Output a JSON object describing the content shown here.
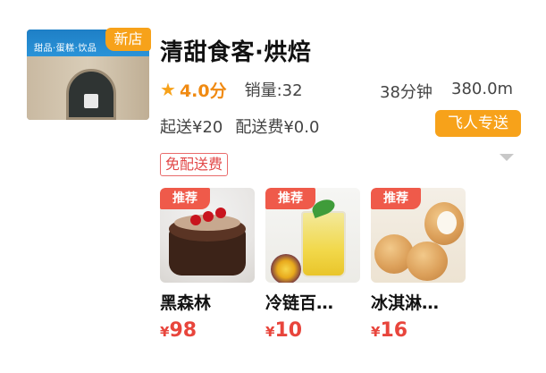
{
  "store": {
    "sign_text": "甜品·蛋糕·饮品",
    "new_badge": "新店",
    "name": "清甜食客·烘焙",
    "rating": "4.0分",
    "sales": "销量:32",
    "delivery_time": "38分钟",
    "distance": "380.0m",
    "min_order": "起送¥20",
    "delivery_fee": "配送费¥0.0",
    "courier_badge": "飞人专送",
    "promo": "免配送费"
  },
  "products": [
    {
      "badge": "推荐",
      "name": "黑森林",
      "currency": "¥",
      "price": "98",
      "image_icon": "black-forest-cake"
    },
    {
      "badge": "推荐",
      "name": "冷链百…",
      "currency": "¥",
      "price": "10",
      "image_icon": "fruit-drink"
    },
    {
      "badge": "推荐",
      "name": "冰淇淋…",
      "currency": "¥",
      "price": "16",
      "image_icon": "cream-puff"
    }
  ],
  "colors": {
    "accent_orange": "#f7a21a",
    "price_red": "#e8453c",
    "promo_red": "#e24848",
    "recommend_red": "#ef5a4a"
  }
}
